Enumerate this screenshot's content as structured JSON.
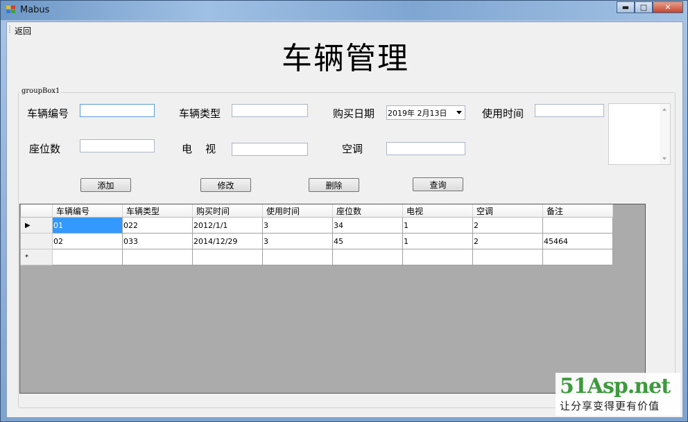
{
  "window": {
    "title": "Mabus"
  },
  "menu": {
    "back_label": "返回"
  },
  "page_title": "车辆管理",
  "groupbox": {
    "label": "groupBox1"
  },
  "form": {
    "vehicle_no_label": "车辆编号",
    "vehicle_type_label": "车辆类型",
    "purchase_date_label": "购买日期",
    "purchase_date_value": "2019年  2月13日",
    "use_time_label": "使用时间",
    "seats_label": "座位数",
    "tv_label": "电    视",
    "ac_label": "空调"
  },
  "buttons": {
    "add": "添加",
    "edit": "修改",
    "delete": "删除",
    "query": "查询"
  },
  "grid": {
    "columns": [
      "车辆编号",
      "车辆类型",
      "购买时间",
      "使用时间",
      "座位数",
      "电视",
      "空调",
      "备注"
    ],
    "rows": [
      {
        "marker": "▶",
        "cells": [
          "01",
          "022",
          "2012/1/1",
          "3",
          "34",
          "1",
          "2",
          ""
        ]
      },
      {
        "marker": "",
        "cells": [
          "02",
          "033",
          "2014/12/29",
          "3",
          "45",
          "1",
          "2",
          "45464"
        ]
      },
      {
        "marker": "*",
        "cells": [
          "",
          "",
          "",
          "",
          "",
          "",
          "",
          ""
        ]
      }
    ]
  },
  "watermark": {
    "main": "51Asp.net",
    "sub": "让分享变得更有价值"
  }
}
